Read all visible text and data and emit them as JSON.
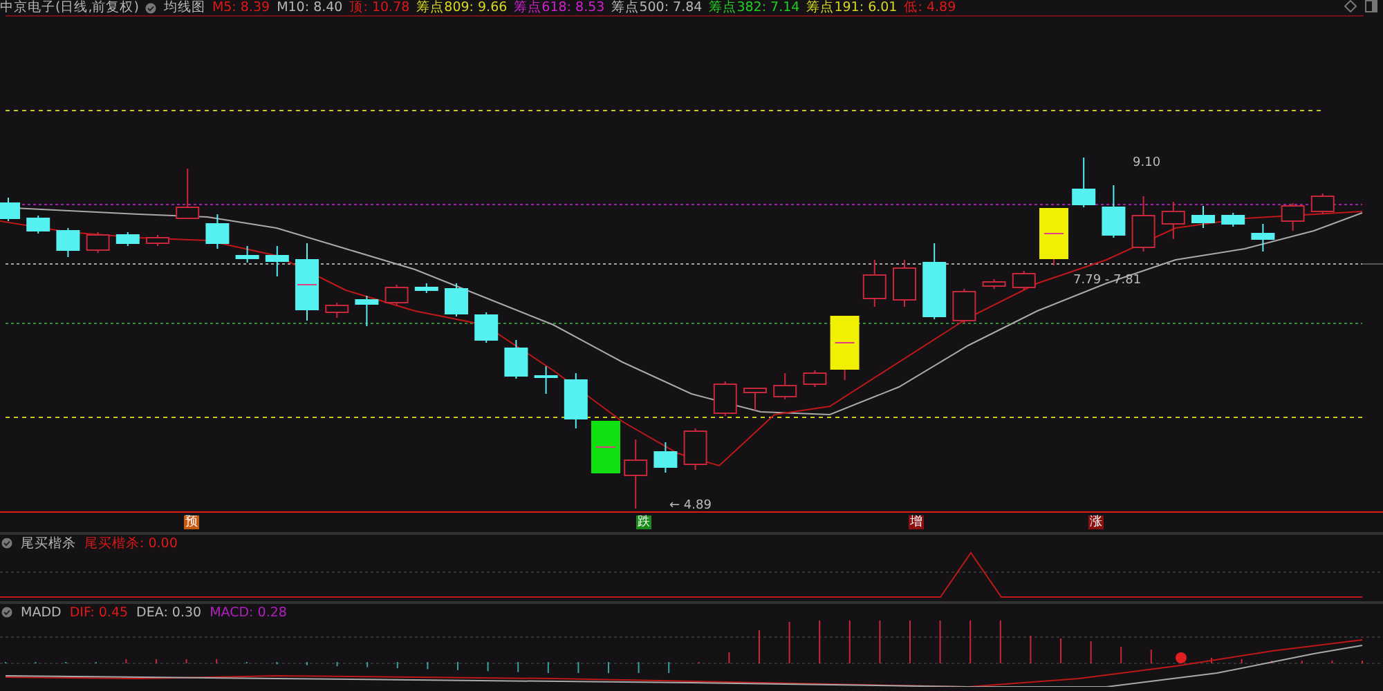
{
  "header": {
    "title": "中京电子(日线,前复权)",
    "indicator": "均线图",
    "stats": [
      {
        "text": "M5: 8.39",
        "color": "#e01818"
      },
      {
        "text": "M10: 8.40",
        "color": "#b8b8b8"
      },
      {
        "text": "顶: 10.78",
        "color": "#e01818"
      },
      {
        "text": "筹点809: 9.66",
        "color": "#d8d820"
      },
      {
        "text": "筹点618: 8.53",
        "color": "#d020d0"
      },
      {
        "text": "筹点500: 7.84",
        "color": "#b8b8b8"
      },
      {
        "text": "筹点382: 7.14",
        "color": "#20d020"
      },
      {
        "text": "筹点191: 6.01",
        "color": "#d8d820"
      },
      {
        "text": "低: 4.89",
        "color": "#e01818"
      }
    ]
  },
  "main_chart": {
    "high_label": "9.10",
    "range_label": "7.79 - 7.81",
    "low_label": "← 4.89"
  },
  "signals": [
    {
      "text": "预",
      "color": "#c85a10"
    },
    {
      "text": "跌",
      "color": "#1a8a1a"
    },
    {
      "text": "增",
      "color": "#8a1010"
    },
    {
      "text": "涨",
      "color": "#8a1010"
    }
  ],
  "panel_2": {
    "name": "尾买楷杀",
    "reading": "尾买楷杀: 0.00"
  },
  "panel_3": {
    "name": "MADD",
    "readings": [
      {
        "text": "DIF: 0.45",
        "color": "#e01818"
      },
      {
        "text": "DEA: 0.30",
        "color": "#b8b8b8"
      },
      {
        "text": "MACD: 0.28",
        "color": "#b020c0"
      }
    ]
  }
}
